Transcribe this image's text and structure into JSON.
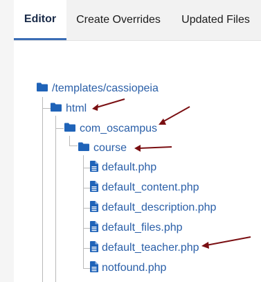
{
  "tabs": [
    {
      "label": "Editor",
      "active": true
    },
    {
      "label": "Create Overrides",
      "active": false
    },
    {
      "label": "Updated Files",
      "active": false
    }
  ],
  "tree": {
    "root": {
      "label": "/templates/cassiopeia",
      "icon": "folder-icon"
    },
    "html": {
      "label": "html",
      "icon": "folder-icon"
    },
    "com_oscampus": {
      "label": "com_oscampus",
      "icon": "folder-icon"
    },
    "course": {
      "label": "course",
      "icon": "folder-icon"
    },
    "files": [
      {
        "label": "default.php",
        "icon": "file-icon"
      },
      {
        "label": "default_content.php",
        "icon": "file-icon"
      },
      {
        "label": "default_description.php",
        "icon": "file-icon"
      },
      {
        "label": "default_files.php",
        "icon": "file-icon"
      },
      {
        "label": "default_teacher.php",
        "icon": "file-icon"
      },
      {
        "label": "notfound.php",
        "icon": "file-icon"
      }
    ]
  },
  "colors": {
    "link": "#2a5fa8",
    "icon": "#1f63b8",
    "arrow": "#7a0f12",
    "tab_active_border": "#3a6db5"
  }
}
